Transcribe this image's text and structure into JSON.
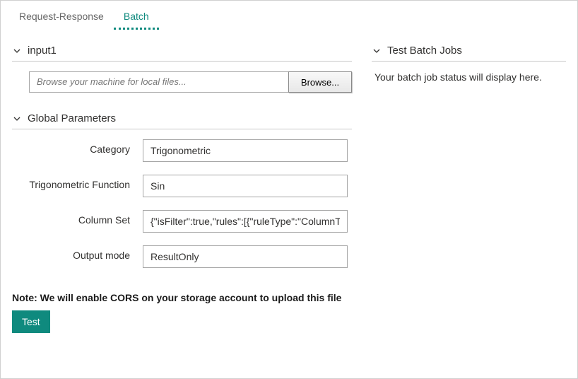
{
  "tabs": {
    "request_response": "Request-Response",
    "batch": "Batch"
  },
  "sections": {
    "input1": {
      "title": "input1",
      "file_placeholder": "Browse your machine for local files...",
      "browse_label": "Browse..."
    },
    "global_params": {
      "title": "Global Parameters",
      "fields": {
        "category": {
          "label": "Category",
          "value": "Trigonometric"
        },
        "trig_function": {
          "label": "Trigonometric Function",
          "value": "Sin"
        },
        "column_set": {
          "label": "Column Set",
          "value": "{\"isFilter\":true,\"rules\":[{\"ruleType\":\"ColumnTyp"
        },
        "output_mode": {
          "label": "Output mode",
          "value": "ResultOnly"
        }
      }
    },
    "test_jobs": {
      "title": "Test Batch Jobs",
      "status": "Your batch job status will display here."
    }
  },
  "note": "Note: We will enable CORS on your storage account to upload this file",
  "test_button": "Test"
}
